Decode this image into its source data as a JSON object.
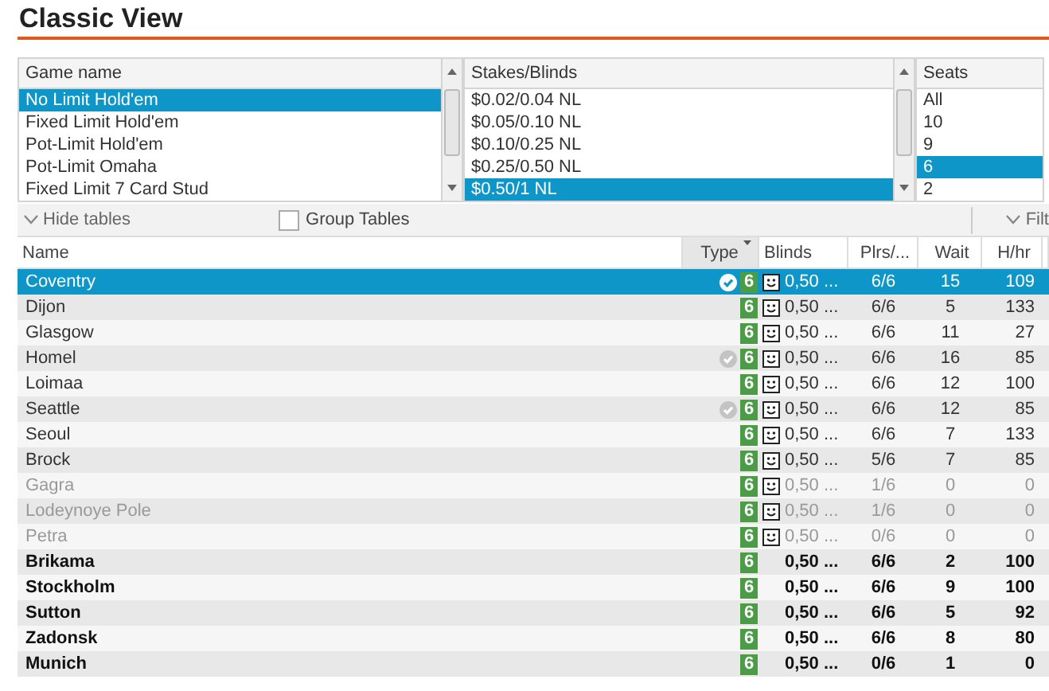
{
  "title": "Classic View",
  "filters": [
    {
      "header": "Game name",
      "items": [
        {
          "label": "No Limit Hold'em",
          "selected": true
        },
        {
          "label": "Fixed Limit Hold'em",
          "selected": false
        },
        {
          "label": "Pot-Limit Hold'em",
          "selected": false
        },
        {
          "label": "Pot-Limit Omaha",
          "selected": false
        },
        {
          "label": "Fixed Limit 7 Card Stud",
          "selected": false
        }
      ]
    },
    {
      "header": "Stakes/Blinds",
      "items": [
        {
          "label": "$0.02/0.04 NL",
          "selected": false
        },
        {
          "label": "$0.05/0.10 NL",
          "selected": false
        },
        {
          "label": "$0.10/0.25 NL",
          "selected": false
        },
        {
          "label": "$0.25/0.50 NL",
          "selected": false
        },
        {
          "label": "$0.50/1 NL",
          "selected": true
        }
      ]
    },
    {
      "header": "Seats",
      "items": [
        {
          "label": "All",
          "selected": false
        },
        {
          "label": "10",
          "selected": false
        },
        {
          "label": "9",
          "selected": false
        },
        {
          "label": "6",
          "selected": true
        },
        {
          "label": "2",
          "selected": false
        }
      ]
    }
  ],
  "toolbar": {
    "hide_tables": "Hide tables",
    "group_tables": {
      "label": "Group Tables",
      "checked": false
    },
    "filter": "Filt"
  },
  "table": {
    "columns": [
      {
        "label": "Name",
        "sorted": false
      },
      {
        "label": "Type",
        "sorted": true
      },
      {
        "label": "Blinds",
        "sorted": false
      },
      {
        "label": "Plrs/...",
        "sorted": false
      },
      {
        "label": "Wait",
        "sorted": false
      },
      {
        "label": "H/hr",
        "sorted": false
      }
    ],
    "rows": [
      {
        "name": "Coventry",
        "selected": true,
        "registered": true,
        "seats": "6",
        "smiley": true,
        "blinds": "0,50 ...",
        "players": "6/6",
        "wait": "15",
        "hands": "109",
        "kind": "normal"
      },
      {
        "name": "Dijon",
        "selected": false,
        "registered": false,
        "seats": "6",
        "smiley": true,
        "blinds": "0,50 ...",
        "players": "6/6",
        "wait": "5",
        "hands": "133",
        "kind": "normal"
      },
      {
        "name": "Glasgow",
        "selected": false,
        "registered": false,
        "seats": "6",
        "smiley": true,
        "blinds": "0,50 ...",
        "players": "6/6",
        "wait": "11",
        "hands": "27",
        "kind": "normal"
      },
      {
        "name": "Homel",
        "selected": false,
        "registered": true,
        "seats": "6",
        "smiley": true,
        "blinds": "0,50 ...",
        "players": "6/6",
        "wait": "16",
        "hands": "85",
        "kind": "normal"
      },
      {
        "name": "Loimaa",
        "selected": false,
        "registered": false,
        "seats": "6",
        "smiley": true,
        "blinds": "0,50 ...",
        "players": "6/6",
        "wait": "12",
        "hands": "100",
        "kind": "normal"
      },
      {
        "name": "Seattle",
        "selected": false,
        "registered": true,
        "seats": "6",
        "smiley": true,
        "blinds": "0,50 ...",
        "players": "6/6",
        "wait": "12",
        "hands": "85",
        "kind": "normal"
      },
      {
        "name": "Seoul",
        "selected": false,
        "registered": false,
        "seats": "6",
        "smiley": true,
        "blinds": "0,50 ...",
        "players": "6/6",
        "wait": "7",
        "hands": "133",
        "kind": "normal"
      },
      {
        "name": "Brock",
        "selected": false,
        "registered": false,
        "seats": "6",
        "smiley": true,
        "blinds": "0,50 ...",
        "players": "5/6",
        "wait": "7",
        "hands": "85",
        "kind": "normal"
      },
      {
        "name": "Gagra",
        "selected": false,
        "registered": false,
        "seats": "6",
        "smiley": true,
        "blinds": "0,50 ...",
        "players": "1/6",
        "wait": "0",
        "hands": "0",
        "kind": "dim"
      },
      {
        "name": "Lodeynoye Pole",
        "selected": false,
        "registered": false,
        "seats": "6",
        "smiley": true,
        "blinds": "0,50 ...",
        "players": "1/6",
        "wait": "0",
        "hands": "0",
        "kind": "dim"
      },
      {
        "name": "Petra",
        "selected": false,
        "registered": false,
        "seats": "6",
        "smiley": true,
        "blinds": "0,50 ...",
        "players": "0/6",
        "wait": "0",
        "hands": "0",
        "kind": "dim"
      },
      {
        "name": "Brikama",
        "selected": false,
        "registered": false,
        "seats": "6",
        "smiley": false,
        "blinds": "0,50 ...",
        "players": "6/6",
        "wait": "2",
        "hands": "100",
        "kind": "bold"
      },
      {
        "name": "Stockholm",
        "selected": false,
        "registered": false,
        "seats": "6",
        "smiley": false,
        "blinds": "0,50 ...",
        "players": "6/6",
        "wait": "9",
        "hands": "100",
        "kind": "bold"
      },
      {
        "name": "Sutton",
        "selected": false,
        "registered": false,
        "seats": "6",
        "smiley": false,
        "blinds": "0,50 ...",
        "players": "6/6",
        "wait": "5",
        "hands": "92",
        "kind": "bold"
      },
      {
        "name": "Zadonsk",
        "selected": false,
        "registered": false,
        "seats": "6",
        "smiley": false,
        "blinds": "0,50 ...",
        "players": "6/6",
        "wait": "8",
        "hands": "80",
        "kind": "bold"
      },
      {
        "name": "Munich",
        "selected": false,
        "registered": false,
        "seats": "6",
        "smiley": false,
        "blinds": "0,50 ...",
        "players": "0/6",
        "wait": "1",
        "hands": "0",
        "kind": "bold"
      }
    ]
  }
}
